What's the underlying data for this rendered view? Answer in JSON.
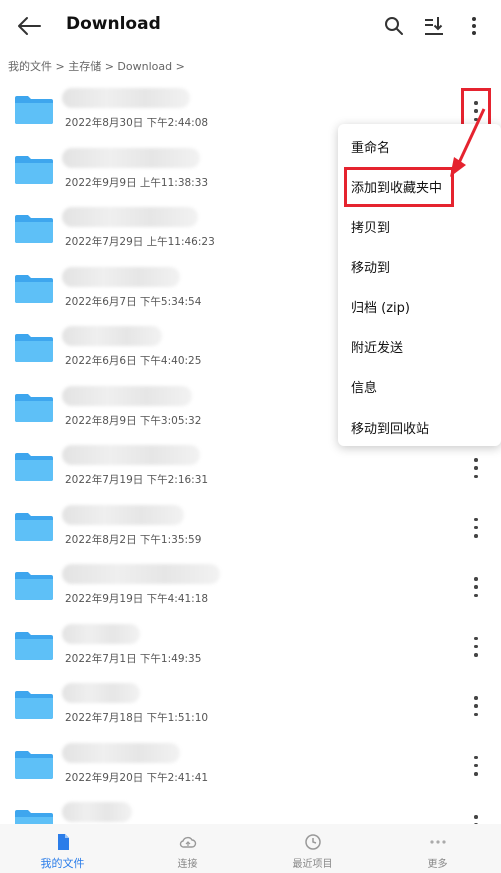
{
  "header": {
    "title": "Download"
  },
  "breadcrumb": "我的文件 > 主存储 > Download >",
  "rows": [
    {
      "date": "2022年8月30日 下午2:44:08",
      "blur_w": 128
    },
    {
      "date": "2022年9月9日 上午11:38:33",
      "blur_w": 138
    },
    {
      "date": "2022年7月29日 上午11:46:23",
      "blur_w": 136
    },
    {
      "date": "2022年6月7日 下午5:34:54",
      "blur_w": 118
    },
    {
      "date": "2022年6月6日 下午4:40:25",
      "blur_w": 100
    },
    {
      "date": "2022年8月9日 下午3:05:32",
      "blur_w": 130
    },
    {
      "date": "2022年7月19日 下午2:16:31",
      "blur_w": 138
    },
    {
      "date": "2022年8月2日 下午1:35:59",
      "blur_w": 122
    },
    {
      "date": "2022年9月19日 下午4:41:18",
      "blur_w": 158
    },
    {
      "date": "2022年7月1日 下午1:49:35",
      "blur_w": 78
    },
    {
      "date": "2022年7月18日 下午1:51:10",
      "blur_w": 78
    },
    {
      "date": "2022年9月20日 下午2:41:41",
      "blur_w": 118
    },
    {
      "date": "",
      "blur_w": 70
    }
  ],
  "menu": {
    "items": [
      "重命名",
      "添加到收藏夹中",
      "拷贝到",
      "移动到",
      "归档 (zip)",
      "附近发送",
      "信息",
      "移动到回收站"
    ]
  },
  "tabs": [
    {
      "label": "我的文件",
      "icon": "file-icon"
    },
    {
      "label": "连接",
      "icon": "cloud-icon"
    },
    {
      "label": "最近项目",
      "icon": "clock-icon"
    },
    {
      "label": "更多",
      "icon": "dots-icon"
    }
  ],
  "colors": {
    "accent": "#2b7de9",
    "highlight": "#e5232f",
    "folder": "#4fb3f2"
  }
}
